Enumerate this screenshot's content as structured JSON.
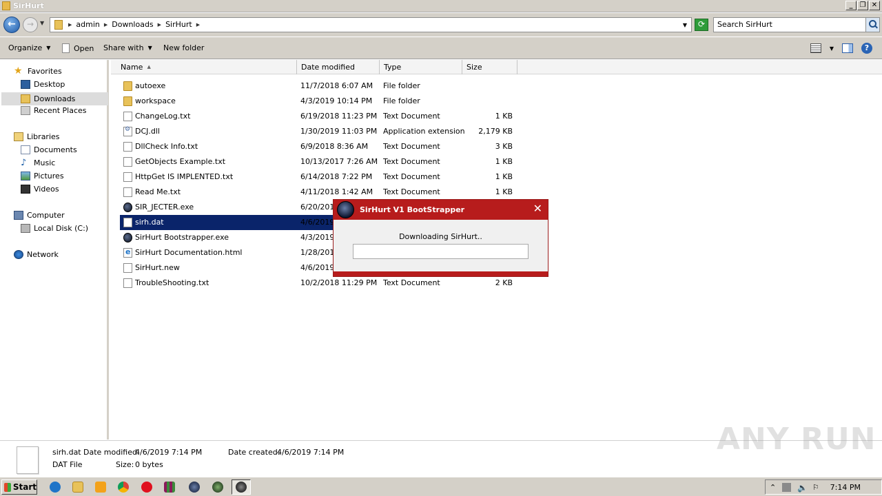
{
  "window": {
    "title": "SirHurt"
  },
  "address": {
    "crumbs": [
      "admin",
      "Downloads",
      "SirHurt"
    ],
    "search_placeholder": "Search SirHurt"
  },
  "toolbar": {
    "organize": "Organize",
    "open": "Open",
    "share_with": "Share with",
    "new_folder": "New folder"
  },
  "nav": {
    "favorites": "Favorites",
    "desktop": "Desktop",
    "downloads": "Downloads",
    "recent_places": "Recent Places",
    "libraries": "Libraries",
    "documents": "Documents",
    "music": "Music",
    "pictures": "Pictures",
    "videos": "Videos",
    "computer": "Computer",
    "local_disk": "Local Disk (C:)",
    "network": "Network"
  },
  "columns": {
    "name": "Name",
    "date": "Date modified",
    "type": "Type",
    "size": "Size"
  },
  "files": [
    {
      "icon": "folder",
      "name": "autoexe",
      "date": "11/7/2018 6:07 AM",
      "type": "File folder",
      "size": ""
    },
    {
      "icon": "folder",
      "name": "workspace",
      "date": "4/3/2019 10:14 PM",
      "type": "File folder",
      "size": ""
    },
    {
      "icon": "text",
      "name": "ChangeLog.txt",
      "date": "6/19/2018 11:23 PM",
      "type": "Text Document",
      "size": "1 KB"
    },
    {
      "icon": "dll",
      "name": "DCJ.dll",
      "date": "1/30/2019 11:03 PM",
      "type": "Application extension",
      "size": "2,179 KB"
    },
    {
      "icon": "text",
      "name": "DllCheck Info.txt",
      "date": "6/9/2018 8:36 AM",
      "type": "Text Document",
      "size": "3 KB"
    },
    {
      "icon": "text",
      "name": "GetObjects Example.txt",
      "date": "10/13/2017 7:26 AM",
      "type": "Text Document",
      "size": "1 KB"
    },
    {
      "icon": "text",
      "name": "HttpGet IS IMPLENTED.txt",
      "date": "6/14/2018 7:22 PM",
      "type": "Text Document",
      "size": "1 KB"
    },
    {
      "icon": "text",
      "name": "Read Me.txt",
      "date": "4/11/2018 1:42 AM",
      "type": "Text Document",
      "size": "1 KB"
    },
    {
      "icon": "exe",
      "name": "SIR_JECTER.exe",
      "date": "6/20/2018",
      "type": "",
      "size": ""
    },
    {
      "icon": "text",
      "name": "sirh.dat",
      "date": "4/6/2019",
      "type": "",
      "size": ""
    },
    {
      "icon": "exe",
      "name": "SirHurt Bootstrapper.exe",
      "date": "4/3/2019",
      "type": "",
      "size": ""
    },
    {
      "icon": "html",
      "name": "SirHurt Documentation.html",
      "date": "1/28/2019",
      "type": "",
      "size": ""
    },
    {
      "icon": "text",
      "name": "SirHurt.new",
      "date": "4/6/2019",
      "type": "",
      "size": ""
    },
    {
      "icon": "text",
      "name": "TroubleShooting.txt",
      "date": "10/2/2018 11:29 PM",
      "type": "Text Document",
      "size": "2 KB"
    }
  ],
  "selected_index": 9,
  "dialog": {
    "title": "SirHurt V1 BootStrapper",
    "close": "✕",
    "status": "Downloading SirHurt..",
    "progress": 0,
    "accent": "#b71c1c"
  },
  "details": {
    "name": "sirh.dat",
    "type": "DAT File",
    "modified_label": "Date modified:",
    "modified_value": "4/6/2019 7:14 PM",
    "created_label": "Date created:",
    "created_value": "4/6/2019 7:14 PM",
    "size_label": "Size:",
    "size_value": "0 bytes"
  },
  "watermark": "ANY RUN",
  "taskbar": {
    "start": "Start",
    "apps": [
      "ie-icon",
      "explorer-icon",
      "media-player-icon",
      "chrome-icon",
      "opera-icon",
      "winrar-icon",
      "sirhurt-icon",
      "app-icon",
      "bootstrapper-icon"
    ],
    "clock": "7:14 PM"
  }
}
